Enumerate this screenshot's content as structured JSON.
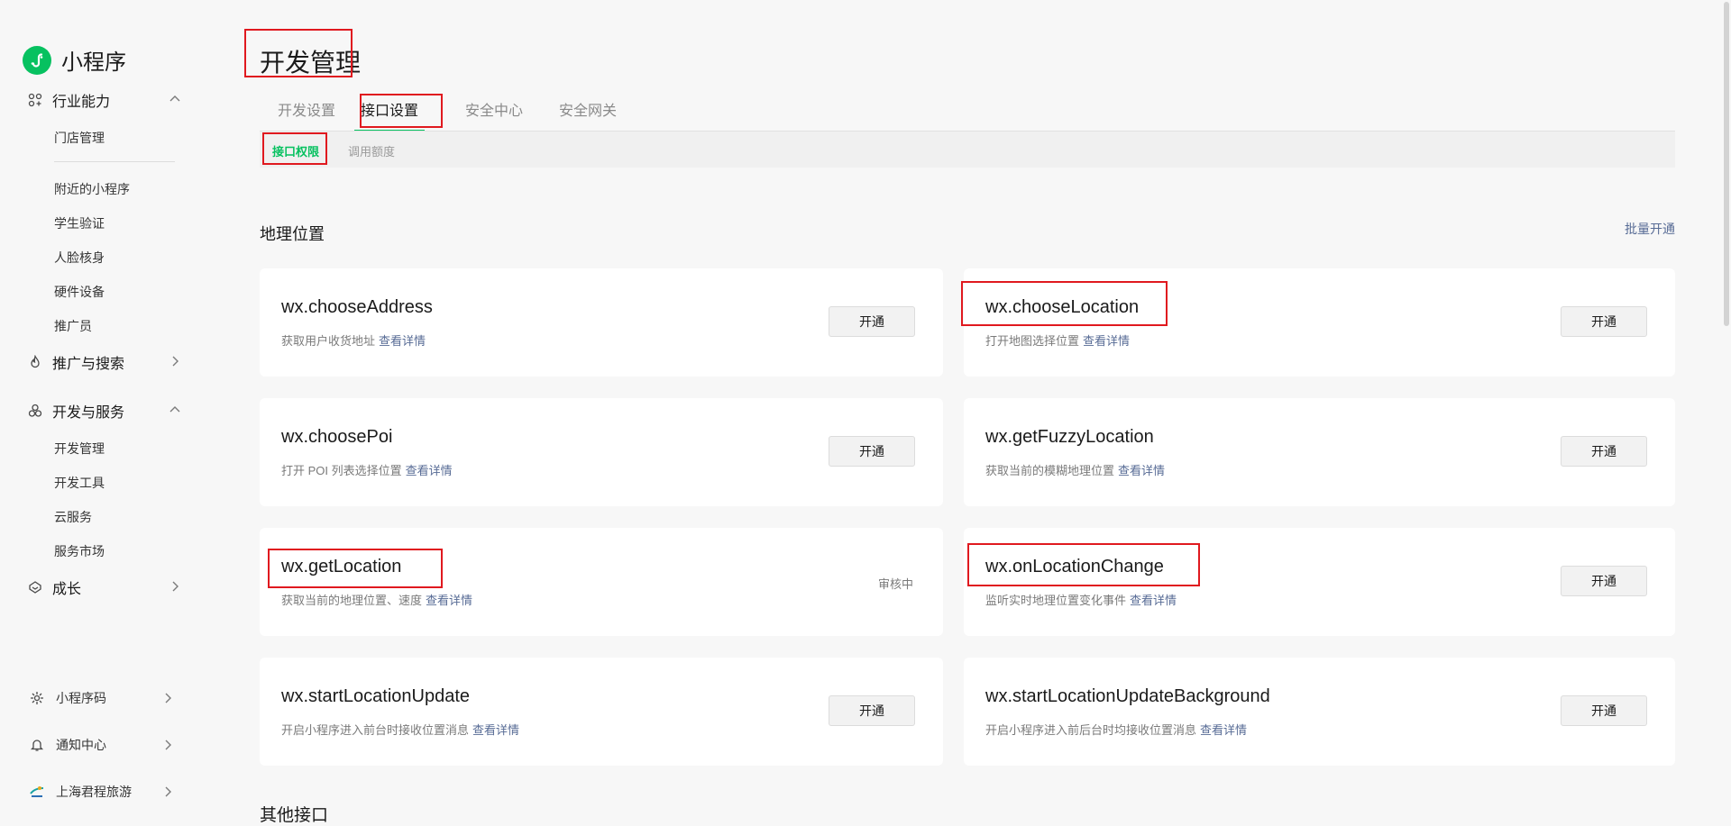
{
  "app": {
    "name": "小程序"
  },
  "sidebar": {
    "groups": [
      {
        "label": "行业能力",
        "icon": "industry-icon",
        "expanded": true
      },
      {
        "label": "推广与搜索",
        "icon": "promotion-icon",
        "expanded": false
      },
      {
        "label": "开发与服务",
        "icon": "dev-service-icon",
        "expanded": true
      },
      {
        "label": "成长",
        "icon": "growth-icon",
        "expanded": false
      }
    ],
    "industry_items": [
      "门店管理",
      "附近的小程序",
      "学生验证",
      "人脸核身",
      "硬件设备",
      "推广员"
    ],
    "dev_items": [
      "开发管理",
      "开发工具",
      "云服务",
      "服务市场"
    ],
    "bottom": [
      {
        "label": "小程序码",
        "icon": "qrcode-icon"
      },
      {
        "label": "通知中心",
        "icon": "bell-icon"
      },
      {
        "label": "上海君程旅游",
        "icon": "account-logo-icon"
      }
    ]
  },
  "page": {
    "title": "开发管理"
  },
  "tabs": [
    {
      "label": "开发设置",
      "active": false
    },
    {
      "label": "接口设置",
      "active": true
    },
    {
      "label": "安全中心",
      "active": false
    },
    {
      "label": "安全网关",
      "active": false
    }
  ],
  "subtabs": [
    {
      "label": "接口权限",
      "active": true
    },
    {
      "label": "调用额度",
      "active": false
    }
  ],
  "sections": {
    "location": {
      "title": "地理位置",
      "batch_label": "批量开通"
    },
    "other": {
      "title": "其他接口"
    }
  },
  "common": {
    "detail_label": "查看详情",
    "enable_label": "开通"
  },
  "apis": [
    {
      "name": "wx.chooseAddress",
      "desc": "获取用户收货地址",
      "status": ""
    },
    {
      "name": "wx.chooseLocation",
      "desc": "打开地图选择位置",
      "status": ""
    },
    {
      "name": "wx.choosePoi",
      "desc": "打开 POI 列表选择位置",
      "status": ""
    },
    {
      "name": "wx.getFuzzyLocation",
      "desc": "获取当前的模糊地理位置",
      "status": ""
    },
    {
      "name": "wx.getLocation",
      "desc": "获取当前的地理位置、速度",
      "status": "审核中"
    },
    {
      "name": "wx.onLocationChange",
      "desc": "监听实时地理位置变化事件",
      "status": ""
    },
    {
      "name": "wx.startLocationUpdate",
      "desc": "开启小程序进入前台时接收位置消息",
      "status": ""
    },
    {
      "name": "wx.startLocationUpdateBackground",
      "desc": "开启小程序进入前后台时均接收位置消息",
      "status": ""
    }
  ],
  "colors": {
    "brand_green": "#07c160",
    "link_blue": "#576b95",
    "highlight_red": "#e0191f"
  }
}
